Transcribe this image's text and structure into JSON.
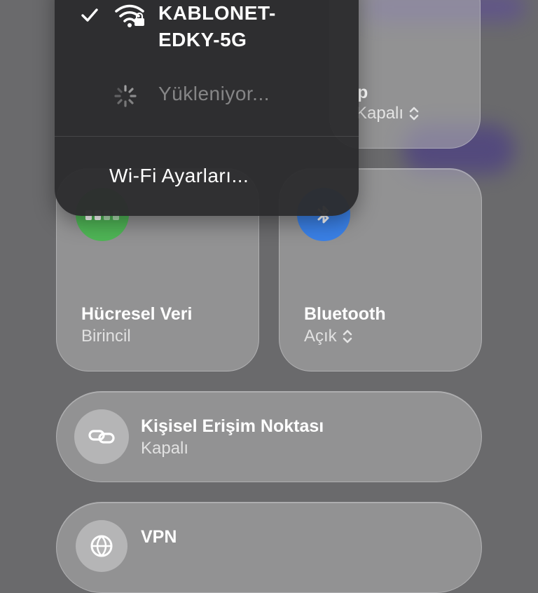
{
  "wifi_menu": {
    "connected_network": "KABLONET-\nEDKY-5G",
    "loading_text": "Yükleniyor...",
    "settings_label": "Wi-Fi Ayarları..."
  },
  "top_right_tile": {
    "title_partial": "p",
    "subtitle_partial": "Kapalı"
  },
  "cellular": {
    "title": "Hücresel Veri",
    "subtitle": "Birincil",
    "color": "#4fb556"
  },
  "bluetooth": {
    "title": "Bluetooth",
    "subtitle": "Açık",
    "color": "#3a80e6"
  },
  "hotspot": {
    "title": "Kişisel Erişim Noktası",
    "subtitle": "Kapalı"
  },
  "vpn": {
    "title": "VPN"
  },
  "icons": {
    "check": "checkmark-icon",
    "wifi": "wifi-lock-icon",
    "spinner": "loading-spinner-icon",
    "cellular": "cellular-bars-icon",
    "bluetooth": "bluetooth-icon",
    "hotspot": "link-icon",
    "vpn": "globe-icon",
    "chevrons": "chevron-updown-icon"
  }
}
